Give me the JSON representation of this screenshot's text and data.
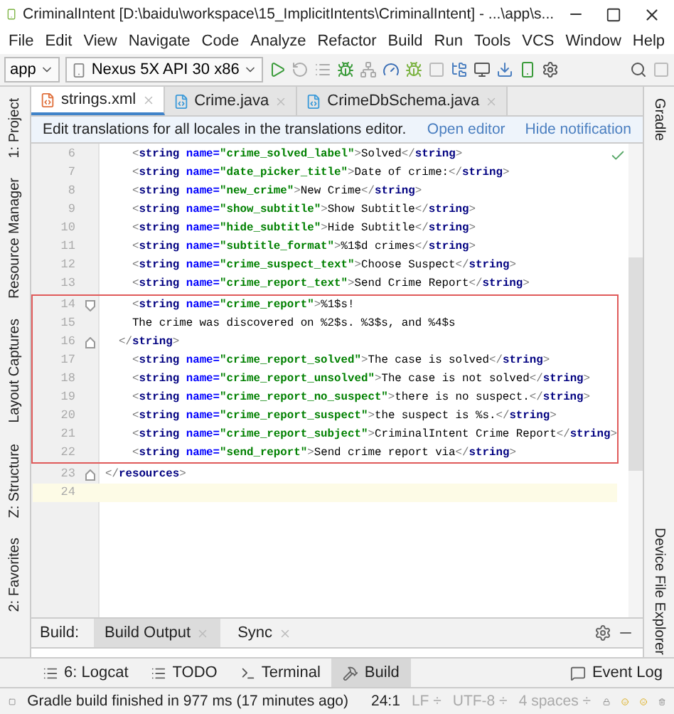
{
  "window": {
    "title": "CriminalIntent [D:\\baidu\\workspace\\15_ImplicitIntents\\CriminalIntent] - ...\\app\\s..."
  },
  "menu": [
    "File",
    "Edit",
    "View",
    "Navigate",
    "Code",
    "Analyze",
    "Refactor",
    "Build",
    "Run",
    "Tools",
    "VCS",
    "Window",
    "Help"
  ],
  "toolbar": {
    "module": "app",
    "device": "Nexus 5X API 30 x86"
  },
  "left_tool_tabs": [
    "1: Project",
    "Resource Manager",
    "Layout Captures",
    "Z: Structure",
    "2: Favorites"
  ],
  "right_tool_tabs": [
    "Gradle",
    "Device File Explorer"
  ],
  "editor_tabs": [
    {
      "label": "strings.xml",
      "selected": true
    },
    {
      "label": "Crime.java",
      "selected": false
    },
    {
      "label": "CrimeDbSchema.java",
      "selected": false
    }
  ],
  "notification": {
    "text": "Edit translations for all locales in the translations editor.",
    "actions": [
      "Open editor",
      "Hide notification"
    ]
  },
  "code": {
    "blocks": [
      {
        "boxed": false,
        "lines": [
          {
            "number": "6",
            "current": false,
            "tokens": [
              {
                "kind": "punct",
                "text": "    <"
              },
              {
                "kind": "tag",
                "text": "string"
              },
              {
                "kind": "attr",
                "text": " name="
              },
              {
                "kind": "value",
                "text": "\"crime_solved_label\""
              },
              {
                "kind": "punct",
                "text": ">"
              },
              {
                "kind": "text",
                "text": "Solved"
              },
              {
                "kind": "punct",
                "text": "</"
              },
              {
                "kind": "tag",
                "text": "string"
              },
              {
                "kind": "punct",
                "text": ">"
              }
            ]
          },
          {
            "number": "7",
            "current": false,
            "tokens": [
              {
                "kind": "punct",
                "text": "    <"
              },
              {
                "kind": "tag",
                "text": "string"
              },
              {
                "kind": "attr",
                "text": " name="
              },
              {
                "kind": "value",
                "text": "\"date_picker_title\""
              },
              {
                "kind": "punct",
                "text": ">"
              },
              {
                "kind": "text",
                "text": "Date of crime:"
              },
              {
                "kind": "punct",
                "text": "</"
              },
              {
                "kind": "tag",
                "text": "string"
              },
              {
                "kind": "punct",
                "text": ">"
              }
            ]
          },
          {
            "number": "8",
            "current": false,
            "tokens": [
              {
                "kind": "punct",
                "text": "    <"
              },
              {
                "kind": "tag",
                "text": "string"
              },
              {
                "kind": "attr",
                "text": " name="
              },
              {
                "kind": "value",
                "text": "\"new_crime\""
              },
              {
                "kind": "punct",
                "text": ">"
              },
              {
                "kind": "text",
                "text": "New Crime"
              },
              {
                "kind": "punct",
                "text": "</"
              },
              {
                "kind": "tag",
                "text": "string"
              },
              {
                "kind": "punct",
                "text": ">"
              }
            ]
          },
          {
            "number": "9",
            "current": false,
            "tokens": [
              {
                "kind": "punct",
                "text": "    <"
              },
              {
                "kind": "tag",
                "text": "string"
              },
              {
                "kind": "attr",
                "text": " name="
              },
              {
                "kind": "value",
                "text": "\"show_subtitle\""
              },
              {
                "kind": "punct",
                "text": ">"
              },
              {
                "kind": "text",
                "text": "Show Subtitle"
              },
              {
                "kind": "punct",
                "text": "</"
              },
              {
                "kind": "tag",
                "text": "string"
              },
              {
                "kind": "punct",
                "text": ">"
              }
            ]
          },
          {
            "number": "10",
            "current": false,
            "tokens": [
              {
                "kind": "punct",
                "text": "    <"
              },
              {
                "kind": "tag",
                "text": "string"
              },
              {
                "kind": "attr",
                "text": " name="
              },
              {
                "kind": "value",
                "text": "\"hide_subtitle\""
              },
              {
                "kind": "punct",
                "text": ">"
              },
              {
                "kind": "text",
                "text": "Hide Subtitle"
              },
              {
                "kind": "punct",
                "text": "</"
              },
              {
                "kind": "tag",
                "text": "string"
              },
              {
                "kind": "punct",
                "text": ">"
              }
            ]
          },
          {
            "number": "11",
            "current": false,
            "tokens": [
              {
                "kind": "punct",
                "text": "    <"
              },
              {
                "kind": "tag",
                "text": "string"
              },
              {
                "kind": "attr",
                "text": " name="
              },
              {
                "kind": "value",
                "text": "\"subtitle_format\""
              },
              {
                "kind": "punct",
                "text": ">"
              },
              {
                "kind": "text",
                "text": "%1$d crimes"
              },
              {
                "kind": "punct",
                "text": "</"
              },
              {
                "kind": "tag",
                "text": "string"
              },
              {
                "kind": "punct",
                "text": ">"
              }
            ]
          },
          {
            "number": "12",
            "current": false,
            "tokens": [
              {
                "kind": "punct",
                "text": "    <"
              },
              {
                "kind": "tag",
                "text": "string"
              },
              {
                "kind": "attr",
                "text": " name="
              },
              {
                "kind": "value",
                "text": "\"crime_suspect_text\""
              },
              {
                "kind": "punct",
                "text": ">"
              },
              {
                "kind": "text",
                "text": "Choose Suspect"
              },
              {
                "kind": "punct",
                "text": "</"
              },
              {
                "kind": "tag",
                "text": "string"
              },
              {
                "kind": "punct",
                "text": ">"
              }
            ]
          },
          {
            "number": "13",
            "current": false,
            "tokens": [
              {
                "kind": "punct",
                "text": "    <"
              },
              {
                "kind": "tag",
                "text": "string"
              },
              {
                "kind": "attr",
                "text": " name="
              },
              {
                "kind": "value",
                "text": "\"crime_report_text\""
              },
              {
                "kind": "punct",
                "text": ">"
              },
              {
                "kind": "text",
                "text": "Send Crime Report"
              },
              {
                "kind": "punct",
                "text": "</"
              },
              {
                "kind": "tag",
                "text": "string"
              },
              {
                "kind": "punct",
                "text": ">"
              }
            ]
          }
        ]
      },
      {
        "boxed": true,
        "lines": [
          {
            "number": "14",
            "current": false,
            "fold_start": true,
            "fold_end": false,
            "tokens": [
              {
                "kind": "punct",
                "text": "    <"
              },
              {
                "kind": "tag",
                "text": "string"
              },
              {
                "kind": "attr",
                "text": " name="
              },
              {
                "kind": "value",
                "text": "\"crime_report\""
              },
              {
                "kind": "punct",
                "text": ">"
              },
              {
                "kind": "text",
                "text": "%1$s!"
              }
            ]
          },
          {
            "number": "15",
            "current": false,
            "tokens": [
              {
                "kind": "text",
                "text": "    The crime was discovered on %2$s. %3$s, and %4$s"
              }
            ]
          },
          {
            "number": "16",
            "current": false,
            "fold_start": false,
            "fold_end": true,
            "tokens": [
              {
                "kind": "punct",
                "text": "  </"
              },
              {
                "kind": "tag",
                "text": "string"
              },
              {
                "kind": "punct",
                "text": ">"
              }
            ]
          },
          {
            "number": "17",
            "current": false,
            "tokens": [
              {
                "kind": "punct",
                "text": "    <"
              },
              {
                "kind": "tag",
                "text": "string"
              },
              {
                "kind": "attr",
                "text": " name="
              },
              {
                "kind": "value",
                "text": "\"crime_report_solved\""
              },
              {
                "kind": "punct",
                "text": ">"
              },
              {
                "kind": "text",
                "text": "The case is solved"
              },
              {
                "kind": "punct",
                "text": "</"
              },
              {
                "kind": "tag",
                "text": "string"
              },
              {
                "kind": "punct",
                "text": ">"
              }
            ]
          },
          {
            "number": "18",
            "current": false,
            "tokens": [
              {
                "kind": "punct",
                "text": "    <"
              },
              {
                "kind": "tag",
                "text": "string"
              },
              {
                "kind": "attr",
                "text": " name="
              },
              {
                "kind": "value",
                "text": "\"crime_report_unsolved\""
              },
              {
                "kind": "punct",
                "text": ">"
              },
              {
                "kind": "text",
                "text": "The case is not solved"
              },
              {
                "kind": "punct",
                "text": "</"
              },
              {
                "kind": "tag",
                "text": "string"
              },
              {
                "kind": "punct",
                "text": ">"
              }
            ]
          },
          {
            "number": "19",
            "current": false,
            "tokens": [
              {
                "kind": "punct",
                "text": "    <"
              },
              {
                "kind": "tag",
                "text": "string"
              },
              {
                "kind": "attr",
                "text": " name="
              },
              {
                "kind": "value",
                "text": "\"crime_report_no_suspect\""
              },
              {
                "kind": "punct",
                "text": ">"
              },
              {
                "kind": "text",
                "text": "there is no suspect."
              },
              {
                "kind": "punct",
                "text": "</"
              },
              {
                "kind": "tag",
                "text": "string"
              },
              {
                "kind": "punct",
                "text": ">"
              }
            ]
          },
          {
            "number": "20",
            "current": false,
            "tokens": [
              {
                "kind": "punct",
                "text": "    <"
              },
              {
                "kind": "tag",
                "text": "string"
              },
              {
                "kind": "attr",
                "text": " name="
              },
              {
                "kind": "value",
                "text": "\"crime_report_suspect\""
              },
              {
                "kind": "punct",
                "text": ">"
              },
              {
                "kind": "text",
                "text": "the suspect is %s."
              },
              {
                "kind": "punct",
                "text": "</"
              },
              {
                "kind": "tag",
                "text": "string"
              },
              {
                "kind": "punct",
                "text": ">"
              }
            ]
          },
          {
            "number": "21",
            "current": false,
            "tokens": [
              {
                "kind": "punct",
                "text": "    <"
              },
              {
                "kind": "tag",
                "text": "string"
              },
              {
                "kind": "attr",
                "text": " name="
              },
              {
                "kind": "value",
                "text": "\"crime_report_subject\""
              },
              {
                "kind": "punct",
                "text": ">"
              },
              {
                "kind": "text",
                "text": "CriminalIntent Crime Report"
              },
              {
                "kind": "punct",
                "text": "</"
              },
              {
                "kind": "tag",
                "text": "string"
              },
              {
                "kind": "punct",
                "text": ">"
              }
            ]
          },
          {
            "number": "22",
            "current": false,
            "tokens": [
              {
                "kind": "punct",
                "text": "    <"
              },
              {
                "kind": "tag",
                "text": "string"
              },
              {
                "kind": "attr",
                "text": " name="
              },
              {
                "kind": "value",
                "text": "\"send_report\""
              },
              {
                "kind": "punct",
                "text": ">"
              },
              {
                "kind": "text",
                "text": "Send crime report via"
              },
              {
                "kind": "punct",
                "text": "</"
              },
              {
                "kind": "tag",
                "text": "string"
              },
              {
                "kind": "punct",
                "text": ">"
              }
            ]
          }
        ]
      },
      {
        "boxed": false,
        "lines": [
          {
            "number": "23",
            "current": false,
            "fold_start": false,
            "fold_end": true,
            "tokens": [
              {
                "kind": "punct",
                "text": "</"
              },
              {
                "kind": "tag",
                "text": "resources"
              },
              {
                "kind": "punct",
                "text": ">"
              }
            ]
          },
          {
            "number": "24",
            "current": true
          }
        ]
      }
    ]
  },
  "build_panel": {
    "label": "Build:",
    "tabs": [
      {
        "label": "Build Output",
        "selected": true
      },
      {
        "label": "Sync",
        "selected": false
      }
    ]
  },
  "tool_windows": [
    {
      "label": "6: Logcat",
      "selected": false
    },
    {
      "label": "TODO",
      "selected": false
    },
    {
      "label": "Terminal",
      "selected": false
    },
    {
      "label": "Build",
      "selected": true
    }
  ],
  "event_log": "Event Log",
  "status_bar": {
    "message": "Gradle build finished in 977 ms (17 minutes ago)",
    "position": "24:1",
    "line_separator": "LF ÷",
    "encoding": "UTF-8 ÷",
    "indent": "4 spaces ÷"
  }
}
